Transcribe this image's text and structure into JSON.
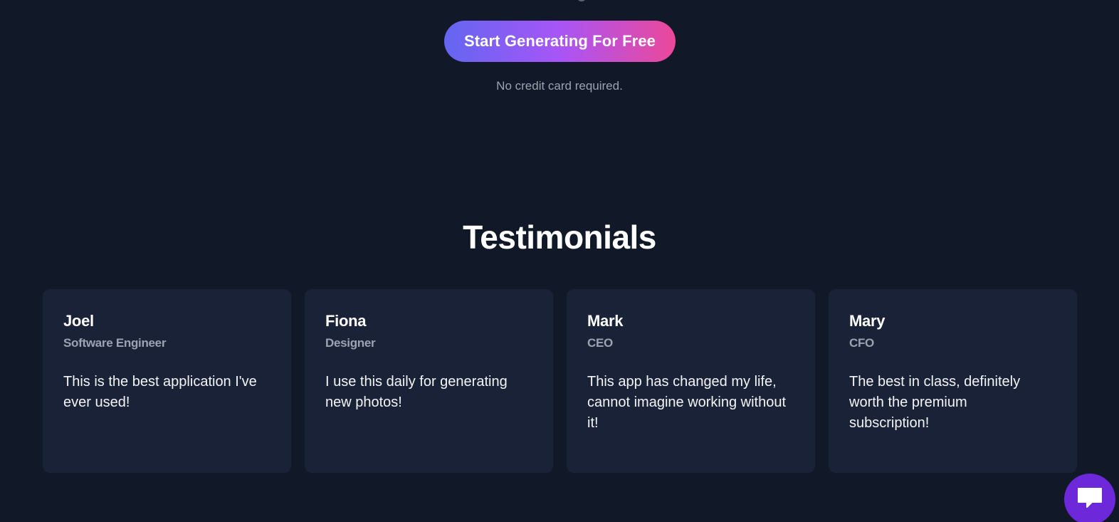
{
  "hero": {
    "cta_label": "Start Generating For Free",
    "cta_note": "No credit card required."
  },
  "testimonials": {
    "title": "Testimonials",
    "items": [
      {
        "name": "Joel",
        "role": "Software Engineer",
        "quote": "This is the best application I've ever used!"
      },
      {
        "name": "Fiona",
        "role": "Designer",
        "quote": "I use this daily for generating new photos!"
      },
      {
        "name": "Mark",
        "role": "CEO",
        "quote": "This app has changed my life, cannot imagine working without it!"
      },
      {
        "name": "Mary",
        "role": "CFO",
        "quote": "The best in class, definitely worth the premium subscription!"
      }
    ]
  },
  "chat_widget": {
    "icon": "chat-bubble-icon"
  },
  "colors": {
    "background": "#111827",
    "card_background": "#1a2238",
    "gradient_start": "#6366f1",
    "gradient_mid": "#a855f7",
    "gradient_end": "#ec4899",
    "muted_text": "#9ca3af",
    "chat_button": "#6d28d9"
  }
}
